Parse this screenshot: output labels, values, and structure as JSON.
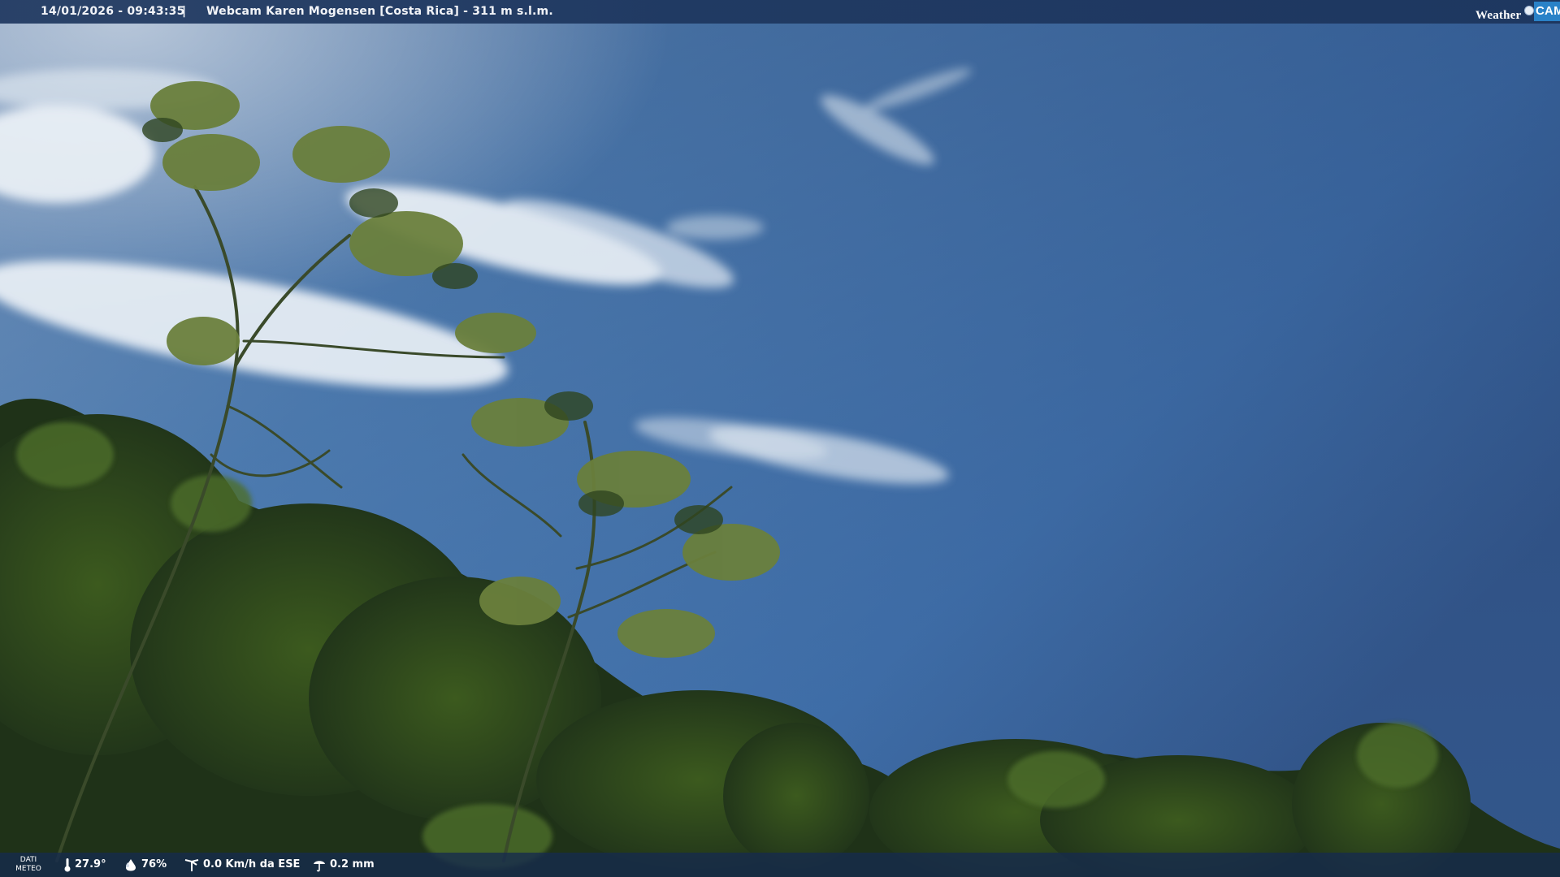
{
  "header": {
    "timestamp": "14/01/2026 - 09:43:35",
    "separator": "|",
    "title": "Webcam Karen Mogensen [Costa Rica] - 311 m s.l.m.",
    "brand_left": "Weather",
    "brand_right": "CAM"
  },
  "footer": {
    "label_line1": "DATI",
    "label_line2": "METEO",
    "temperature": "27.9°",
    "humidity": "76%",
    "wind": "0.0 Km/h da ESE",
    "rain": "0.2 mm"
  },
  "icons": {
    "temperature": "thermometer-icon",
    "humidity": "drop-icon",
    "wind": "wind-vane-icon",
    "rain": "rain-icon"
  },
  "colors": {
    "bar": "#1e375f",
    "sky_top": "#5b83b2",
    "sky_bottom": "#3a6aa6",
    "brand_accent": "#2a82c8"
  }
}
